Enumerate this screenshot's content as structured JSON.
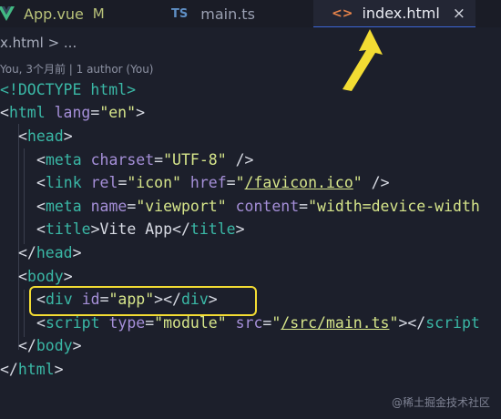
{
  "tabs": [
    {
      "name": "App.vue",
      "badge": "M",
      "icon": "vue-icon"
    },
    {
      "name": "main.ts",
      "icon_text": "TS"
    },
    {
      "name": "index.html",
      "icon_text": "<>",
      "close": "×",
      "active": true
    }
  ],
  "breadcrumb": "x.html > ...",
  "blame": "You, 3个月前 | 1 author (You)",
  "code_lines": [
    "<!DOCTYPE html>",
    "<html lang=\"en\">",
    "<head>",
    "<meta charset=\"UTF-8\" />",
    "<link rel=\"icon\" href=\"/favicon.ico\" />",
    "<meta name=\"viewport\" content=\"width=device-width",
    "<title>Vite App</title>",
    "</head>",
    "<body>",
    "<div id=\"app\"></div>",
    "<script type=\"module\" src=\"/src/main.ts\"></script",
    "</body>",
    "</html>"
  ],
  "watermark": "@稀土掘金技术社区",
  "colors": {
    "editor_bg": "#1c1f2b",
    "tag": "#3ab8a6",
    "attribute": "#a58fd8",
    "string": "#d6e58a",
    "highlight": "#f3dc33"
  }
}
